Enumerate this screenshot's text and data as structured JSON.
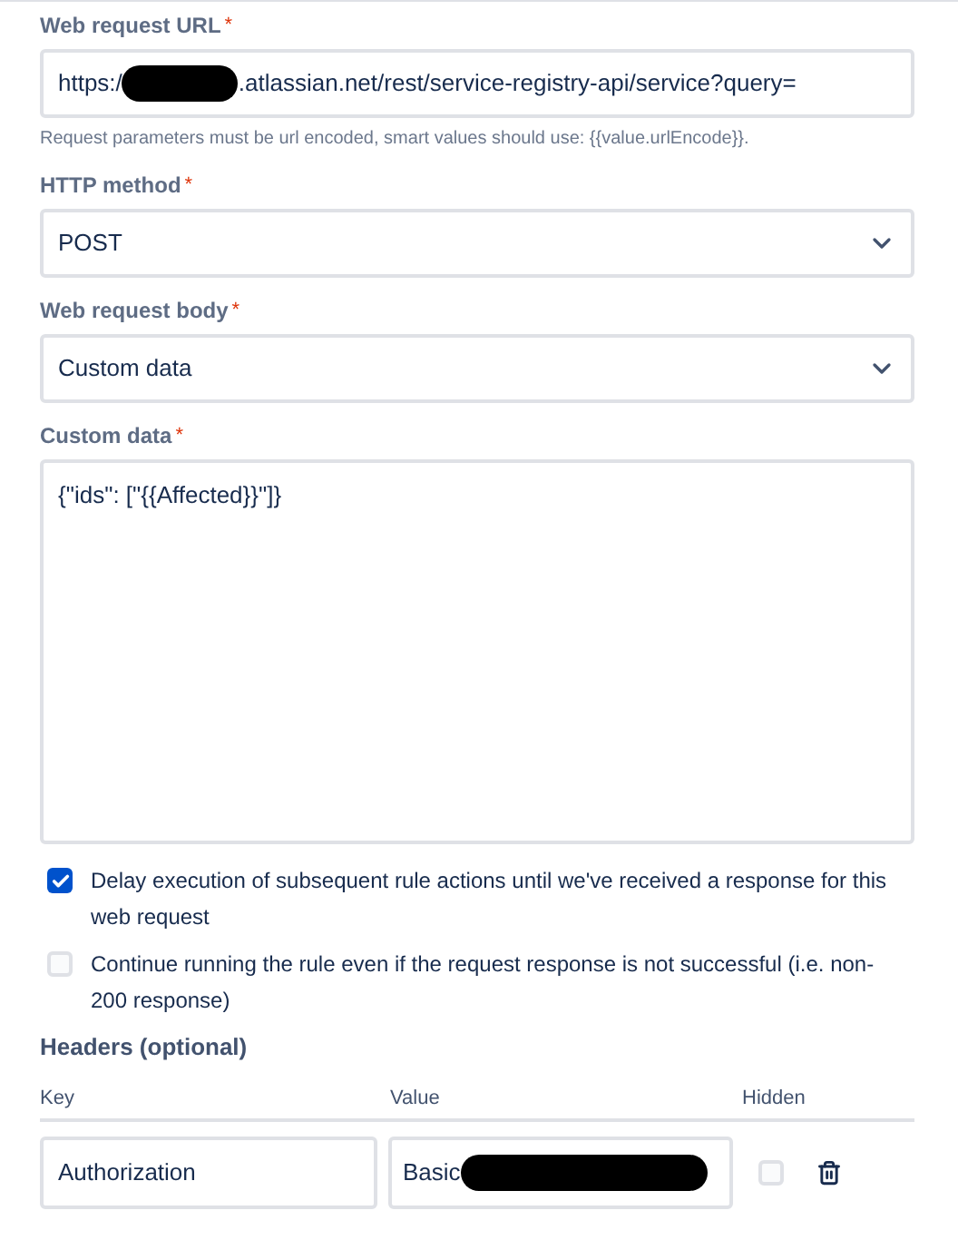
{
  "fields": [
    {
      "kind": "text",
      "label": "Web request URL",
      "required_mark": "*",
      "value_start": "https:/",
      "redacted": true,
      "value_end": ".atlassian.net/rest/service-registry-api/service?query=",
      "help": "Request parameters must be url encoded, smart values should use: {{value.urlEncode}}."
    },
    {
      "kind": "select",
      "label": "HTTP method",
      "required_mark": "*",
      "value": "POST"
    },
    {
      "kind": "select",
      "label": "Web request body",
      "required_mark": "*",
      "value": "Custom data"
    },
    {
      "kind": "textarea",
      "label": "Custom data",
      "required_mark": "*",
      "value": "{\"ids\": [\"{{Affected}}\"]}"
    }
  ],
  "options": [
    {
      "label": "Delay execution of subsequent rule actions until we've received a response for this web request",
      "checked": true
    },
    {
      "label": "Continue running the rule even if the request response is not successful (i.e. non-200 response)",
      "checked": false
    }
  ],
  "headers": {
    "title": "Headers (optional)",
    "columns": [
      "Key",
      "Value",
      "Hidden"
    ],
    "rows": [
      {
        "key": "Authorization",
        "value": "Basic",
        "redacted": true,
        "hidden": false
      }
    ]
  }
}
